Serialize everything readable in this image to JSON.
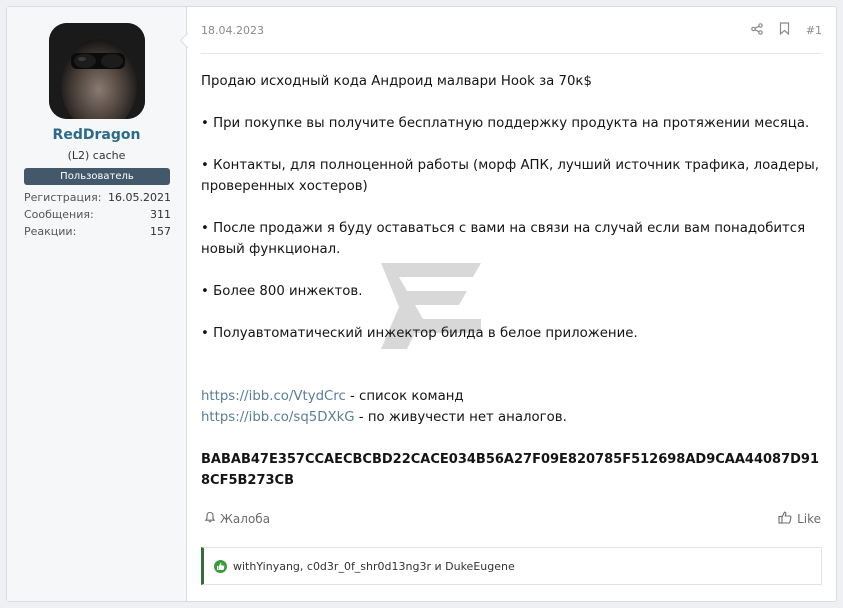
{
  "user": {
    "name": "RedDragon",
    "title": "(L2) cache",
    "banner": "Пользователь",
    "stats": [
      {
        "label": "Регистрация:",
        "value": "16.05.2021"
      },
      {
        "label": "Сообщения:",
        "value": "311"
      },
      {
        "label": "Реакции:",
        "value": "157"
      }
    ]
  },
  "post": {
    "date": "18.04.2023",
    "number": "#1",
    "lines": [
      "Продаю исходный кода Андроид малвари Hook за 70к$",
      "• При покупке вы получите бесплатную поддержку продукта на протяжении месяца.",
      "• Контакты, для полноценной работы (морф АПК, лучший источник трафика, лоадеры, проверенных хостеров)",
      "• После продажи я буду оставаться с вами на связи на случай если вам понадобится новый функционал.",
      "• Более 800 инжектов.",
      "• Полуавтоматический инжектор билда в белое приложение."
    ],
    "links": [
      {
        "url": "https://ibb.co/VtydCrc",
        "text": " - список команд"
      },
      {
        "url": "https://ibb.co/sq5DXkG",
        "text": " - по живучести нет аналогов."
      }
    ],
    "hash": "BABAB47E357CCAECBCBD22CACE034B56A27F09E820785F512698AD9CAA44087D918CF5B273CB"
  },
  "footer": {
    "report_label": "Жалоба",
    "like_label": "Like",
    "reactions_text": "withYinyang, c0d3r_0f_shr0d13ng3r и DukeEugene"
  },
  "colors": {
    "accent": "#2c6a8a",
    "link": "#5a7e97",
    "banner": "#44586b",
    "like_green": "#3b9a3b"
  },
  "icons": [
    "share-icon",
    "bookmark-icon",
    "alert-icon",
    "thumbs-up-icon",
    "like-badge-icon"
  ]
}
